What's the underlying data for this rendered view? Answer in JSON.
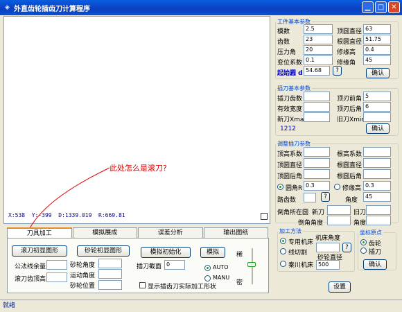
{
  "window": {
    "title": "外直齿轮插齿刀计算程序",
    "app_icon": "app-logo",
    "colors": {
      "title_bar": "#0a4fd0",
      "annotation": "#e00000"
    }
  },
  "plot": {
    "coords": "X:538  Y:-399  D:1339.019  R:669.81",
    "annotation": "此处怎么是滚刀?"
  },
  "tabs": [
    "刀具加工",
    "模拟展成",
    "误差分析",
    "输出图纸"
  ],
  "tool_panel": {
    "hob_button": "滚刀初显图形",
    "wheel_button": "砂轮初显图形",
    "sim_init_button": "模拟初始化",
    "sim_button": "模拟",
    "normal_allowance_label": "公法线余量",
    "hob_addendum_label": "滚刀齿顶高",
    "wheel_angle_label": "砂轮角度",
    "motion_angle_label": "运动角度",
    "wheel_pos_label": "砂轮位置",
    "section_label": "插刀截面",
    "section_value": "0",
    "auto_label": "AUTO",
    "manu_label": "MANU",
    "sparse_label": "稀",
    "dense_label": "密",
    "show_shape_label": "显示插齿刀实际加工形状"
  },
  "workpiece": {
    "legend": "工件基本参数",
    "module_label": "模数",
    "module": "2.5",
    "tip_dia_label": "顶圆直径",
    "tip_dia": "63",
    "teeth_label": "齿数",
    "teeth": "23",
    "root_dia_label": "根圆直径",
    "root_dia": "51.75",
    "pressure_label": "压力角",
    "pressure": "20",
    "mod_height_label": "修缘高",
    "mod_height": "0.4",
    "shift_label": "变位系数",
    "shift": "0.1",
    "mod_angle_label": "修缘角",
    "mod_angle": "45",
    "start_circle_label": "起始圆 d",
    "start_circle": "54.68",
    "help": "?",
    "confirm": "确认"
  },
  "cutter": {
    "legend": "插刀基本参数",
    "teeth_label": "插刀齿数",
    "teeth": "5",
    "rake_label": "顶刃前角",
    "effective_width_label": "有效宽度",
    "clearance_label": "顶刃后角",
    "clearance": "6",
    "new_xmax_label": "新刀Xmax",
    "old_xmin_label": "旧刀Xmin",
    "number": "1212",
    "confirm": "确认"
  },
  "adjust": {
    "legend": "调整插刀参数",
    "tip_coef_label": "顶高系数",
    "root_coef_label": "根高系数",
    "tip_dia_label": "顶圆直径",
    "root_dia_label": "根圆直径",
    "tip_back_label": "顶圆后角",
    "root_back_label": "根圆后角",
    "fillet_r_label": "圆角R",
    "fillet_r": "0.3",
    "mod_height_label": "修缘高",
    "mod_height": "0.3",
    "path_label": "路齿数",
    "help": "?",
    "angle_label": "角度",
    "angle": "45",
    "fillet_circle_label": "倒角所在圆",
    "new_label": "新刀",
    "old_label": "旧刀",
    "fillet_angle_label": "倒角角度",
    "degree_label": "角度"
  },
  "method": {
    "legend": "加工方法",
    "special_label": "专用机床",
    "wire_label": "线切割",
    "qinchuan_label": "秦川机床",
    "machine_angle_label": "机床角度",
    "wheel_dia_label": "砂轮直径",
    "wheel_dia": "500",
    "help": "?"
  },
  "origin": {
    "legend": "坐标原点",
    "gear_label": "齿轮",
    "cutter_label": "插刀",
    "confirm": "确认"
  },
  "settings_button": "设置",
  "status": "就绪"
}
